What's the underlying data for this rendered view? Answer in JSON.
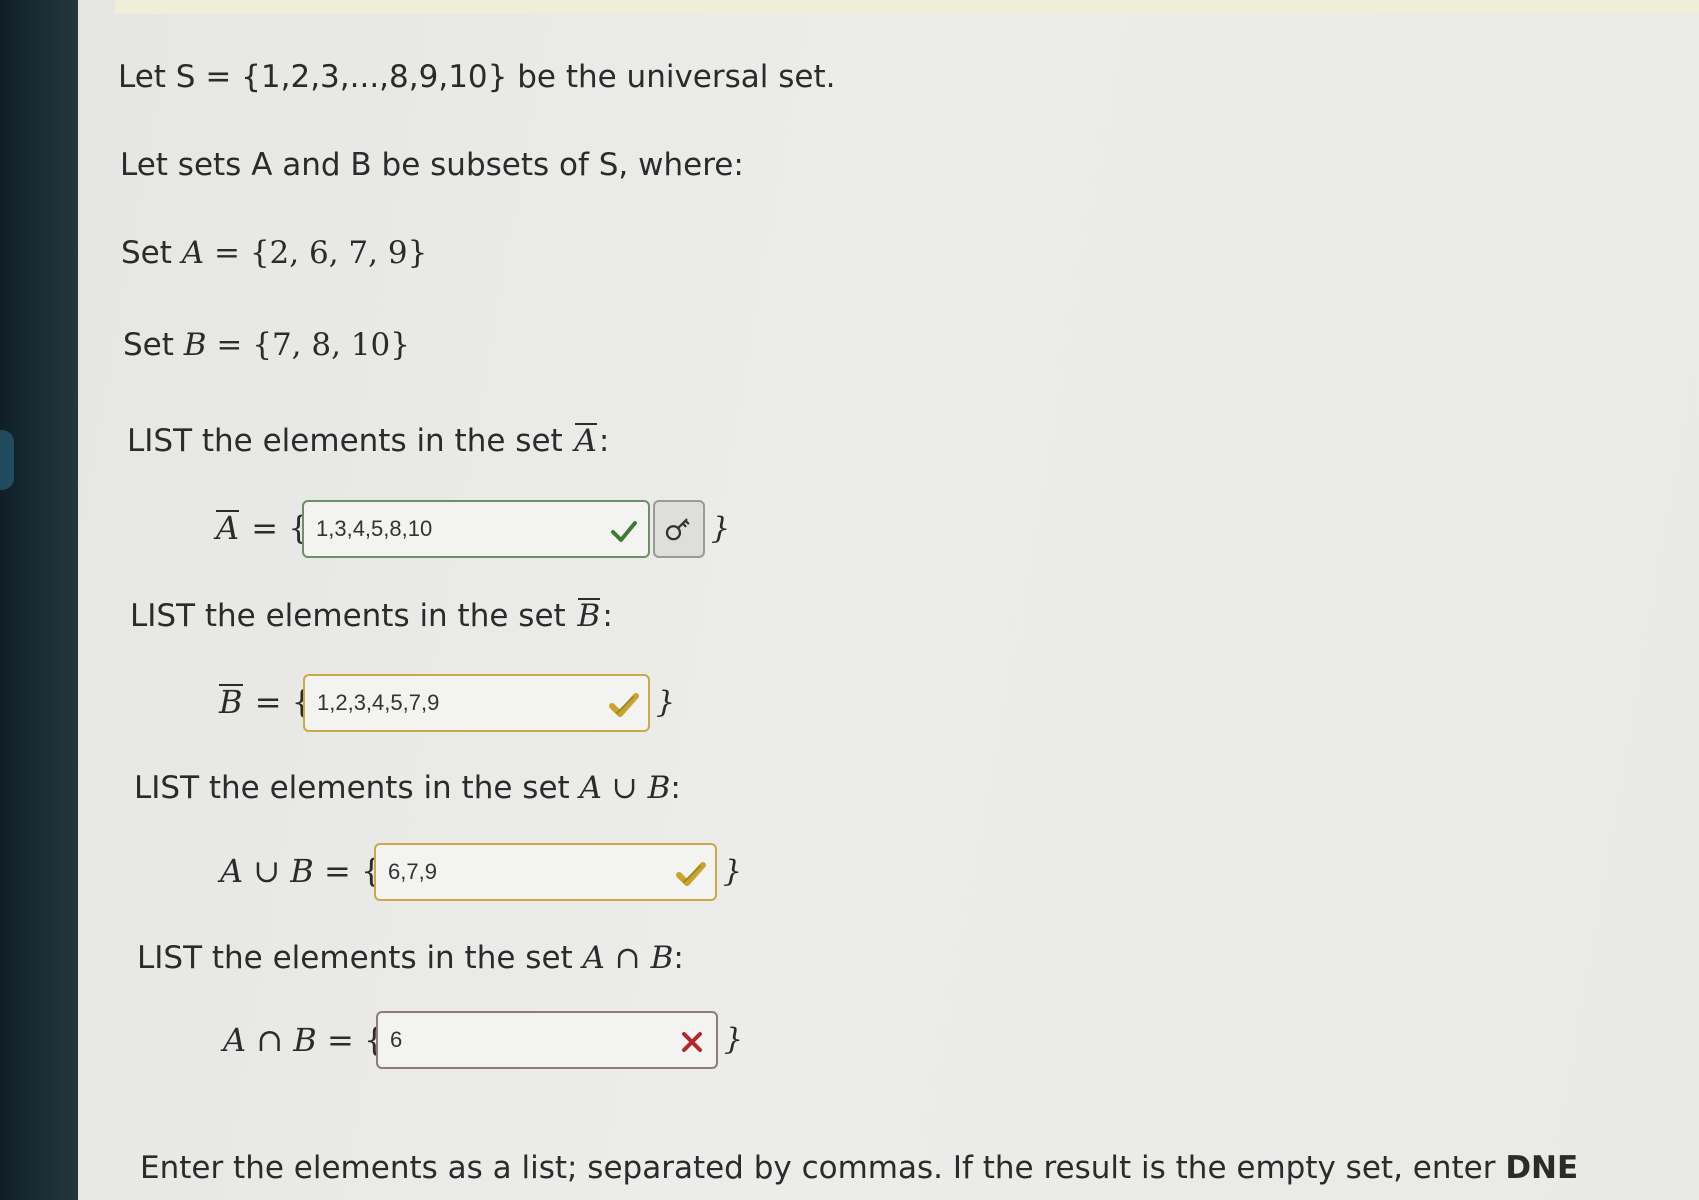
{
  "intro": {
    "line1": "Let S = {1,2,3,...,8,9,10} be the universal set.",
    "line2": "Let sets A and B be subsets of S, where:"
  },
  "sets": {
    "a_label": "Set",
    "a_name": "A",
    "a_value": " = {2, 6, 7, 9}",
    "b_label": "Set",
    "b_name": "B",
    "b_value": " = {7, 8, 10}"
  },
  "questions": [
    {
      "prompt_prefix": "LIST the elements in the set",
      "prompt_symbol": "A",
      "prompt_suffix": ":",
      "lhs": "A",
      "lhs_suffix": " = {",
      "answer": "1,3,4,5,8,10",
      "status": "correct",
      "close": "}"
    },
    {
      "prompt_prefix": "LIST the elements in the set",
      "prompt_symbol": "B",
      "prompt_suffix": ":",
      "lhs": "B",
      "lhs_suffix": " = {",
      "answer": "1,2,3,4,5,7,9",
      "status": "partial",
      "close": "}"
    },
    {
      "prompt_prefix": "LIST the elements in the set",
      "prompt_symbol": "A ∪ B",
      "prompt_suffix": ":",
      "lhs": "A ∪ B",
      "lhs_suffix": " = {",
      "answer": "6,7,9",
      "status": "partial",
      "close": "}"
    },
    {
      "prompt_prefix": "LIST the elements in the set",
      "prompt_symbol": "A ∩ B",
      "prompt_suffix": ":",
      "lhs": "A ∩ B",
      "lhs_suffix": " = {",
      "answer": "6",
      "status": "wrong",
      "close": "}"
    }
  ],
  "footer": {
    "text": "Enter the elements as a list; separated by commas. If the result is the empty set, enter ",
    "bold": "DNE"
  },
  "colors": {
    "correct": "#3f7a34",
    "partial": "#c9a32a",
    "wrong": "#b3262b"
  },
  "icons": {
    "correct": "check-icon",
    "partial": "partial-check-icon",
    "wrong": "x-icon",
    "key_button": "key-icon"
  }
}
